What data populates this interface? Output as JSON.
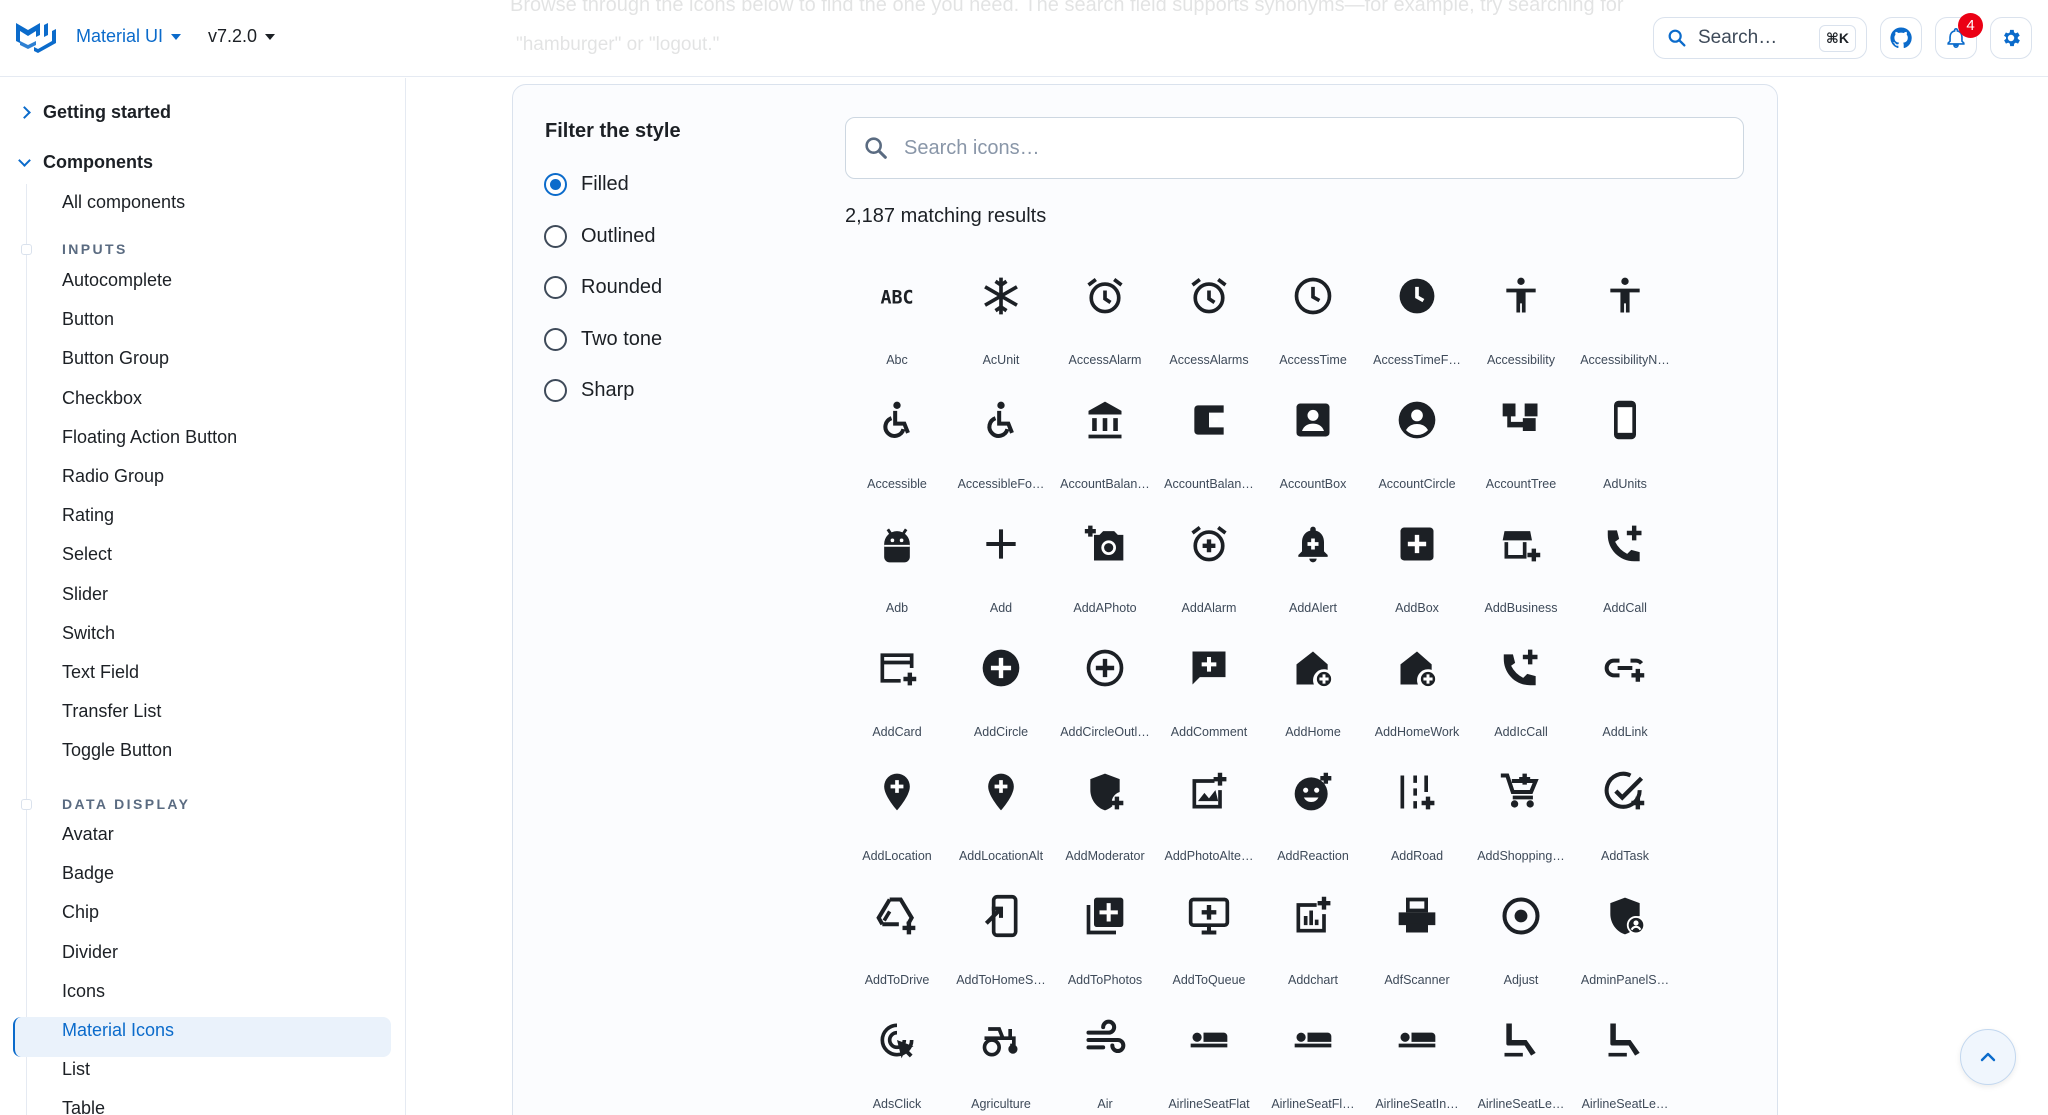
{
  "header": {
    "brand": "Material UI",
    "version": "v7.2.0",
    "faded_line_1": "Browse through the icons below to find the one you need. The search field supports synonyms—for example, try searching for",
    "faded_line_2": "\"hamburger\" or \"logout.\"",
    "search_label": "Search…",
    "search_shortcut": "⌘K",
    "notifications_count": "4",
    "accent_color": "#0b6bcb"
  },
  "sidebar": {
    "getting_started": "Getting started",
    "components": "Components",
    "all_components": "All components",
    "section_inputs": "INPUTS",
    "inputs": [
      "Autocomplete",
      "Button",
      "Button Group",
      "Checkbox",
      "Floating Action Button",
      "Radio Group",
      "Rating",
      "Select",
      "Slider",
      "Switch",
      "Text Field",
      "Transfer List",
      "Toggle Button"
    ],
    "section_data_display": "DATA DISPLAY",
    "data_display": [
      "Avatar",
      "Badge",
      "Chip",
      "Divider",
      "Icons",
      "Material Icons",
      "List",
      "Table"
    ],
    "active_item": "Material Icons"
  },
  "filter": {
    "title": "Filter the style",
    "options": [
      "Filled",
      "Outlined",
      "Rounded",
      "Two tone",
      "Sharp"
    ],
    "selected": "Filled"
  },
  "icon_search": {
    "placeholder": "Search icons…",
    "value": ""
  },
  "results_text": "2,187 matching results",
  "icons": [
    "Abc",
    "AcUnit",
    "AccessAlarm",
    "AccessAlarms",
    "AccessTime",
    "AccessTimeF…",
    "Accessibility",
    "AccessibilityN…",
    "Accessible",
    "AccessibleFo…",
    "AccountBalan…",
    "AccountBalan…",
    "AccountBox",
    "AccountCircle",
    "AccountTree",
    "AdUnits",
    "Adb",
    "Add",
    "AddAPhoto",
    "AddAlarm",
    "AddAlert",
    "AddBox",
    "AddBusiness",
    "AddCall",
    "AddCard",
    "AddCircle",
    "AddCircleOutl…",
    "AddComment",
    "AddHome",
    "AddHomeWork",
    "AddIcCall",
    "AddLink",
    "AddLocation",
    "AddLocationAlt",
    "AddModerator",
    "AddPhotoAlte…",
    "AddReaction",
    "AddRoad",
    "AddShopping…",
    "AddTask",
    "AddToDrive",
    "AddToHomeS…",
    "AddToPhotos",
    "AddToQueue",
    "Addchart",
    "AdfScanner",
    "Adjust",
    "AdminPanelS…",
    "AdsClick",
    "Agriculture",
    "Air",
    "AirlineSeatFlat",
    "AirlineSeatFl…",
    "AirlineSeatIn…",
    "AirlineSeatLe…",
    "AirlineSeatLe…"
  ],
  "icon_kinds": [
    "abc",
    "snow",
    "alarm",
    "alarm",
    "clock",
    "clock-filled",
    "person",
    "person",
    "wheelchair",
    "wheelchair",
    "bank",
    "wallet",
    "account-box",
    "account-circle",
    "tree",
    "phone",
    "android",
    "plus",
    "camera",
    "alarm-plus",
    "bell-plus",
    "box-plus",
    "store-plus",
    "call-plus",
    "card-plus",
    "circle-plus",
    "circle-plus-outline",
    "comment-plus",
    "home-plus",
    "home-plus",
    "call-plus",
    "link-plus",
    "pin-plus",
    "pin-plus",
    "shield-plus",
    "image-plus",
    "smile-plus",
    "road-plus",
    "cart-plus",
    "check-plus",
    "drive-plus",
    "phone-arrow",
    "photos-plus",
    "monitor-plus",
    "chart-plus",
    "printer",
    "target",
    "shield-person",
    "click",
    "tractor",
    "wind",
    "seat-flat",
    "seat-flat",
    "seat-flat",
    "seat",
    "seat"
  ]
}
